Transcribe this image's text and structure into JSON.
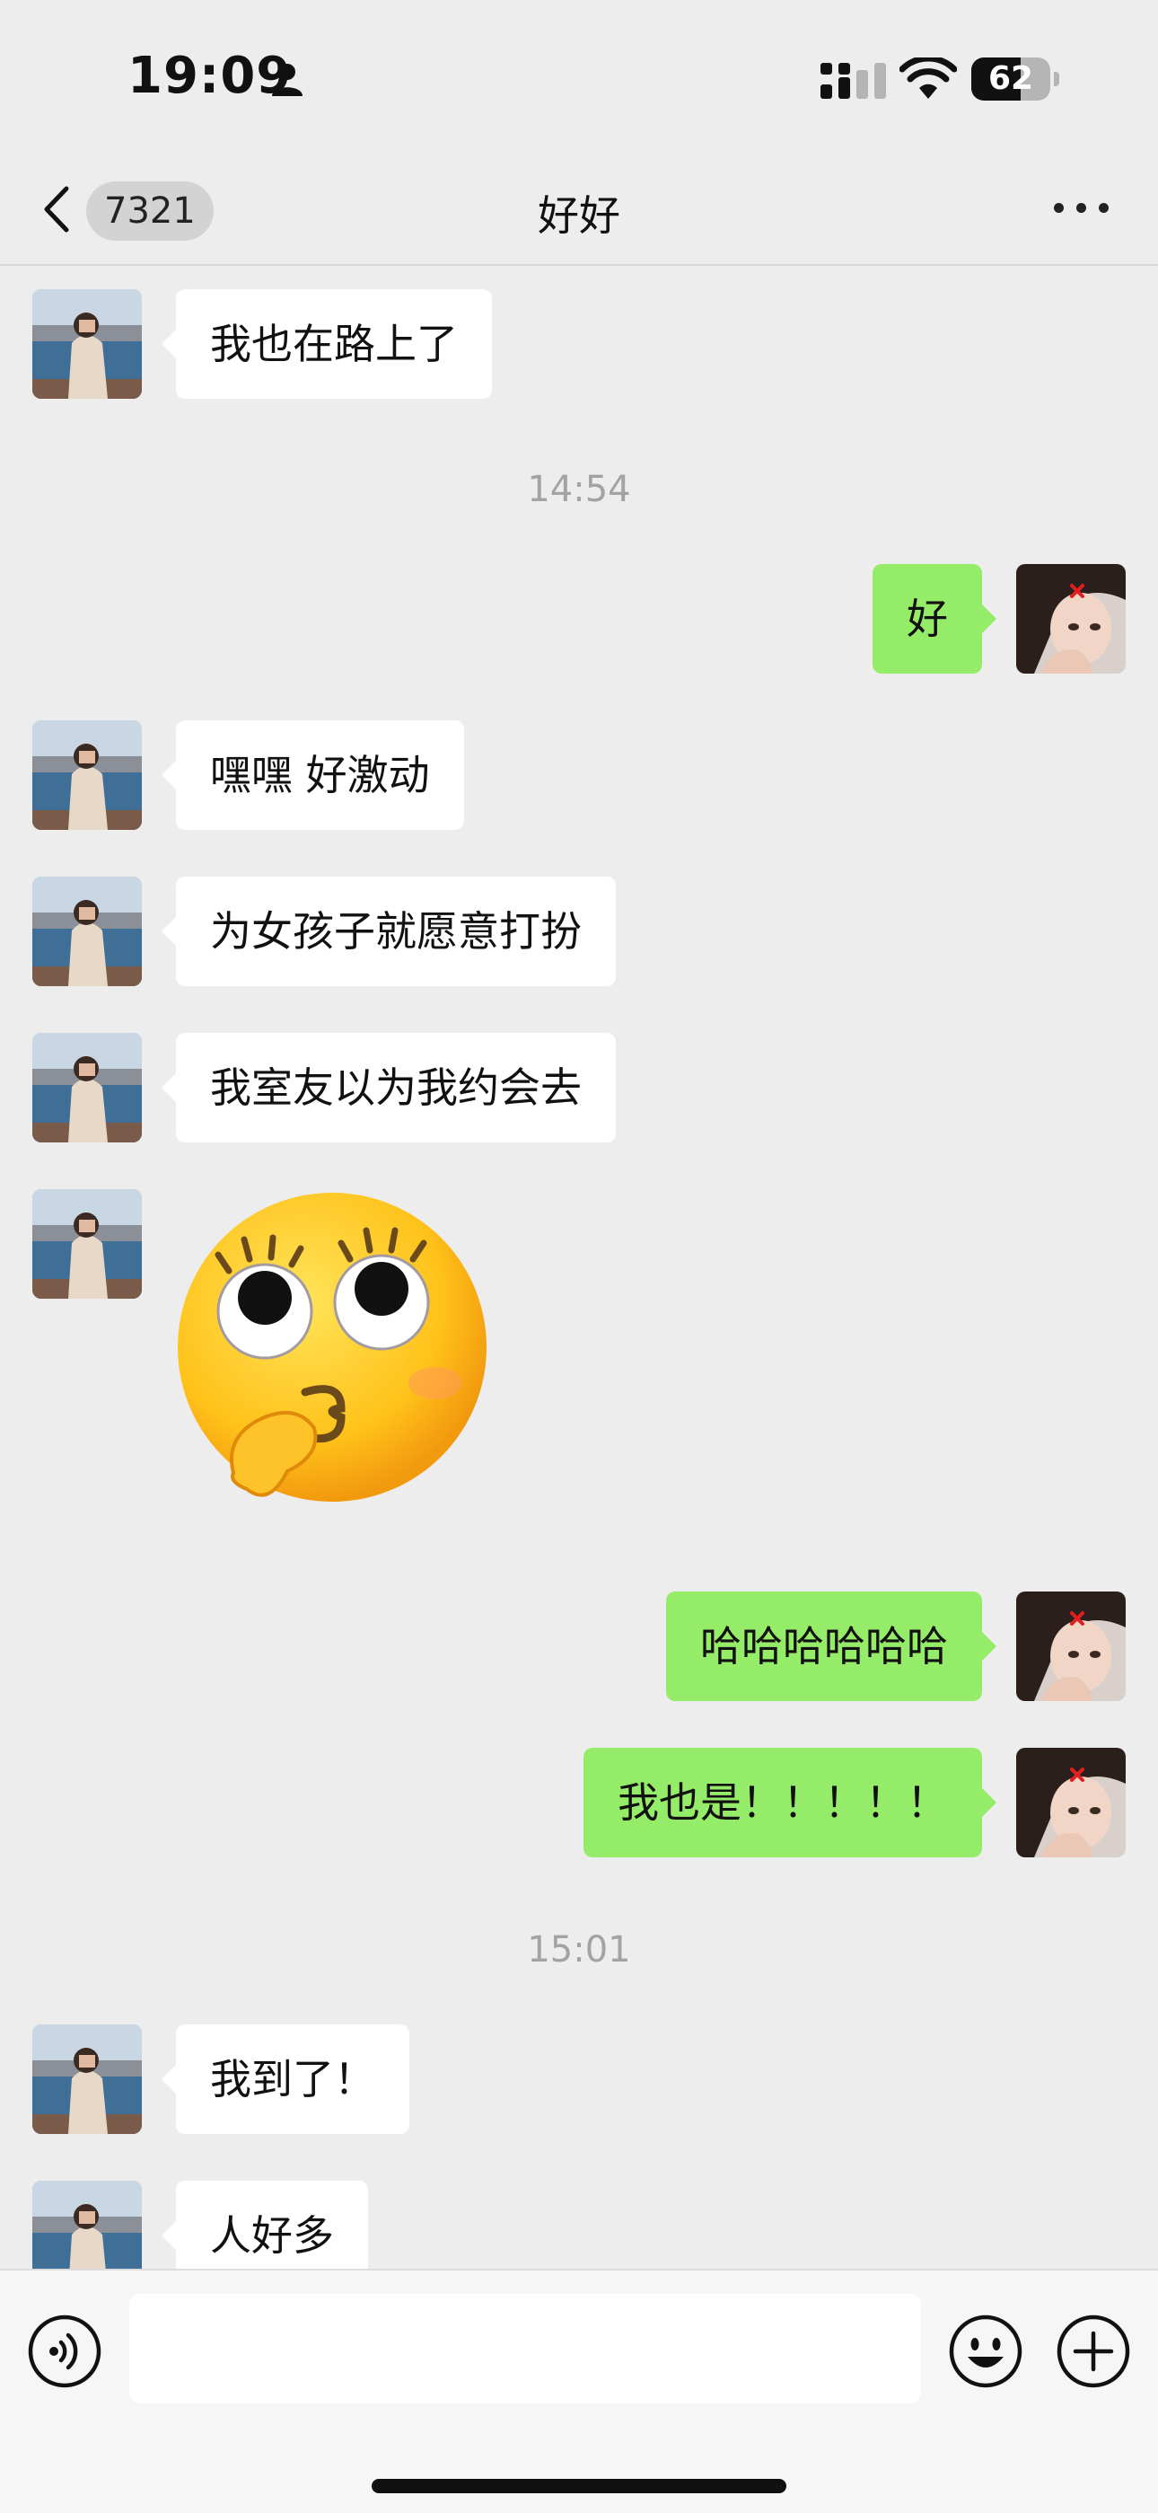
{
  "status_bar": {
    "time": "19:09",
    "battery": "62",
    "battery_level": 0.62
  },
  "nav": {
    "back_count": "7321",
    "title": "好好"
  },
  "messages": {
    "m1": "我也在路上了",
    "ts1": "14:54",
    "m2": "好",
    "m3": "嘿嘿 好激动",
    "m4": "为女孩子就愿意打扮",
    "m5": "我室友以为我约会去",
    "m6": "哈哈哈哈哈哈",
    "m7": "我也是！！！！！",
    "ts2": "15:01",
    "m8": "我到了！",
    "m9": "人好多"
  },
  "input": {
    "value": ""
  },
  "icons": {
    "back": "chevron-left-icon",
    "more": "more-dots-icon",
    "voice": "voice-icon",
    "emoji": "emoji-icon",
    "plus": "plus-icon",
    "sticker": "thinking-face-emoji-sticker"
  },
  "colors": {
    "background": "#ededed",
    "sent_bubble": "#95ec69",
    "received_bubble": "#ffffff",
    "timestamp": "#a3a3a3"
  }
}
